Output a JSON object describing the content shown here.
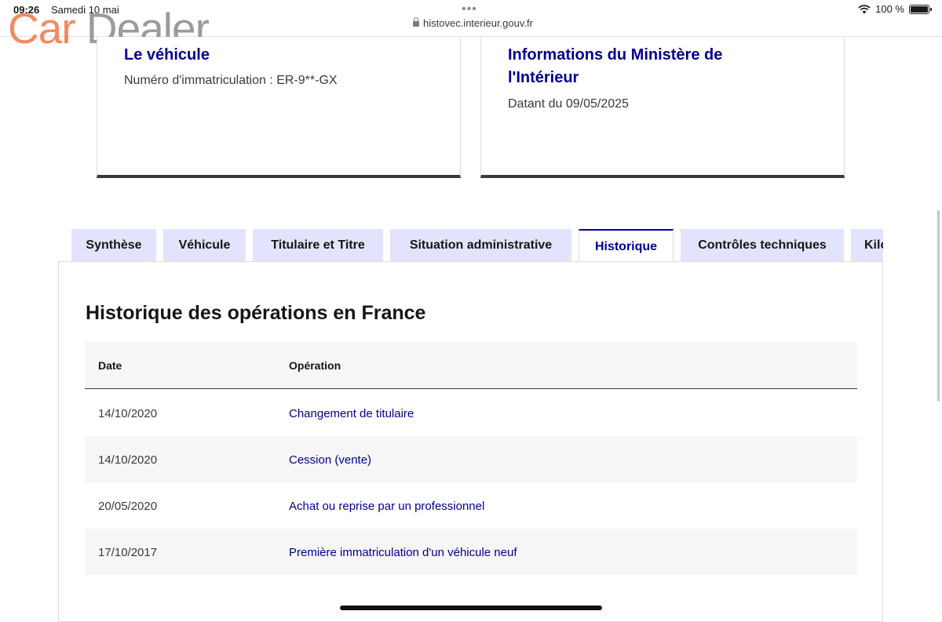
{
  "status_bar": {
    "time": "09:26",
    "date": "Samedi 10 mai",
    "dots": "•••",
    "url": "histovec.interieur.gouv.fr",
    "battery": "100 %"
  },
  "watermark": {
    "car": "Car",
    "dealer": "Dealer"
  },
  "cards": [
    {
      "title": "Le véhicule",
      "text": "Numéro d'immatriculation : ER-9**-GX"
    },
    {
      "title": "Informations du Ministère de l'Intérieur",
      "text": "Datant du 09/05/2025"
    }
  ],
  "tabs": [
    {
      "label": "Synthèse",
      "active": false
    },
    {
      "label": "Véhicule",
      "active": false
    },
    {
      "label": "Titulaire et Titre",
      "active": false
    },
    {
      "label": "Situation administrative",
      "active": false
    },
    {
      "label": "Historique",
      "active": true
    },
    {
      "label": "Contrôles techniques",
      "active": false
    },
    {
      "label": "Kilométrage",
      "active": false
    }
  ],
  "section": {
    "title": "Historique des opérations en France",
    "columns": [
      "Date",
      "Opération"
    ],
    "rows": [
      {
        "date": "14/10/2020",
        "operation": "Changement de titulaire"
      },
      {
        "date": "14/10/2020",
        "operation": "Cession (vente)"
      },
      {
        "date": "20/05/2020",
        "operation": "Achat ou reprise par un professionnel"
      },
      {
        "date": "17/10/2017",
        "operation": "Première immatriculation d'un véhicule neuf"
      }
    ]
  },
  "colors": {
    "accent": "#000091",
    "tab_bg": "#e3e3fd",
    "row_alt": "#f6f6f6"
  }
}
